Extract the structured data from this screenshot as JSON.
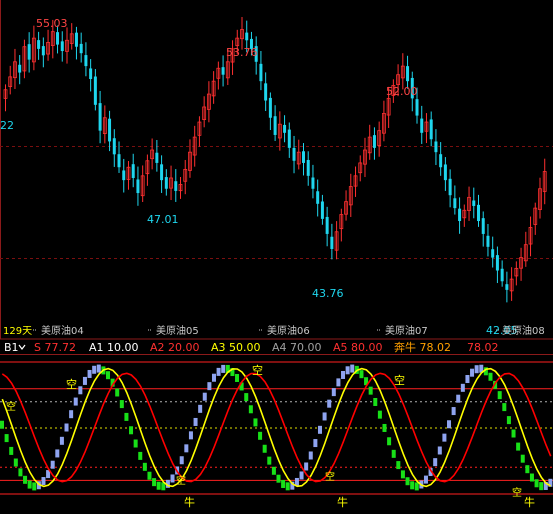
{
  "colors": {
    "background": "#000000",
    "frame": "#8b1a1a",
    "grid_price": "#7a0f0f",
    "candle_up": "#ff3030",
    "candle_down": "#1fd6ee",
    "label_high": "#ff4545",
    "label_low": "#1fd6ee",
    "axis_text": "#c8c8c8",
    "osc_up": "#8fa4f0",
    "osc_down": "#18e018",
    "line_yellow": "#ffff00",
    "line_red": "#ff0000",
    "ref_red": "#ff2020",
    "ref_gray": "#b0b0b0",
    "ref_yellow": "#e0e000",
    "signal": "#ffff00"
  },
  "price_panel": {
    "left_value": "22",
    "period": "129天",
    "month_labels": [
      "美原油04",
      "美原油05",
      "美原油06",
      "美原油07",
      "美原油08"
    ],
    "annotations": [
      {
        "text": "55.03",
        "kind": "high"
      },
      {
        "text": "53.76",
        "kind": "high"
      },
      {
        "text": "52.00",
        "kind": "high"
      },
      {
        "text": "47.01",
        "kind": "low"
      },
      {
        "text": "43.76",
        "kind": "low"
      },
      {
        "text": "42.05",
        "kind": "low"
      }
    ]
  },
  "indicator_bar": {
    "name": "B1",
    "items": [
      {
        "text": "S 77.72",
        "color": "#ff3030"
      },
      {
        "text": "A1 10.00",
        "color": "#ffffff"
      },
      {
        "text": "A2 20.00",
        "color": "#ff3030"
      },
      {
        "text": "A3 50.00",
        "color": "#ffff00"
      },
      {
        "text": "A4 70.00",
        "color": "#a0a0a0"
      },
      {
        "text": "A5 80.00",
        "color": "#ff3030"
      },
      {
        "text": "奔牛 78.02",
        "color": "#ffa000"
      },
      {
        "text": "78.02",
        "color": "#ff3030"
      }
    ]
  },
  "signals": {
    "sell_text": "空",
    "buy_text": "牛"
  },
  "chart_data": [
    {
      "type": "candlestick",
      "title": "美原油",
      "x_labels": [
        "美原油04",
        "美原油05",
        "美原油06",
        "美原油07",
        "美原油08"
      ],
      "annotated_extremes": [
        {
          "label": "55.03",
          "value": 55.03,
          "kind": "high"
        },
        {
          "label": "47.01",
          "value": 47.01,
          "kind": "low"
        },
        {
          "label": "53.76",
          "value": 53.76,
          "kind": "high"
        },
        {
          "label": "43.76",
          "value": 43.76,
          "kind": "low"
        },
        {
          "label": "52.00",
          "value": 52.0,
          "kind": "high"
        },
        {
          "label": "42.05",
          "value": 42.05,
          "kind": "low"
        }
      ],
      "closes": [
        52.2,
        52.8,
        53.5,
        53.0,
        54.2,
        53.6,
        54.6,
        54.1,
        53.8,
        54.4,
        54.9,
        54.3,
        54.0,
        54.5,
        54.8,
        54.2,
        53.9,
        53.3,
        52.7,
        51.5,
        50.3,
        50.9,
        49.8,
        49.2,
        48.6,
        48.0,
        48.6,
        48.1,
        47.4,
        48.2,
        48.9,
        49.4,
        48.8,
        48.0,
        47.6,
        48.1,
        47.5,
        47.8,
        48.5,
        49.3,
        50.0,
        50.7,
        51.4,
        52.0,
        52.6,
        53.2,
        52.9,
        53.5,
        54.1,
        54.6,
        55.0,
        54.5,
        54.1,
        53.5,
        52.6,
        51.7,
        50.9,
        50.1,
        50.6,
        50.2,
        49.5,
        48.9,
        49.3,
        48.8,
        48.2,
        47.6,
        46.9,
        46.2,
        45.5,
        44.8,
        45.6,
        46.4,
        47.0,
        47.7,
        48.2,
        48.8,
        49.4,
        50.0,
        49.5,
        50.3,
        51.1,
        51.8,
        52.4,
        52.9,
        53.3,
        52.6,
        51.8,
        51.0,
        50.2,
        50.7,
        49.9,
        49.3,
        48.6,
        48.0,
        47.3,
        46.7,
        46.1,
        46.6,
        47.2,
        46.8,
        46.1,
        45.5,
        44.9,
        44.4,
        43.8,
        43.3,
        42.9,
        43.4,
        43.9,
        44.4,
        45.0,
        45.8,
        46.7,
        47.6,
        48.4
      ],
      "oscillator": {
        "ref_levels": [
          10,
          20,
          50,
          70,
          80
        ],
        "ylim": [
          0,
          100
        ],
        "S": 77.72,
        "A1": 10.0,
        "A2": 20.0,
        "A3": 50.0,
        "A4": 70.0,
        "A5": 80.0,
        "benniu": 78.02
      }
    }
  ]
}
